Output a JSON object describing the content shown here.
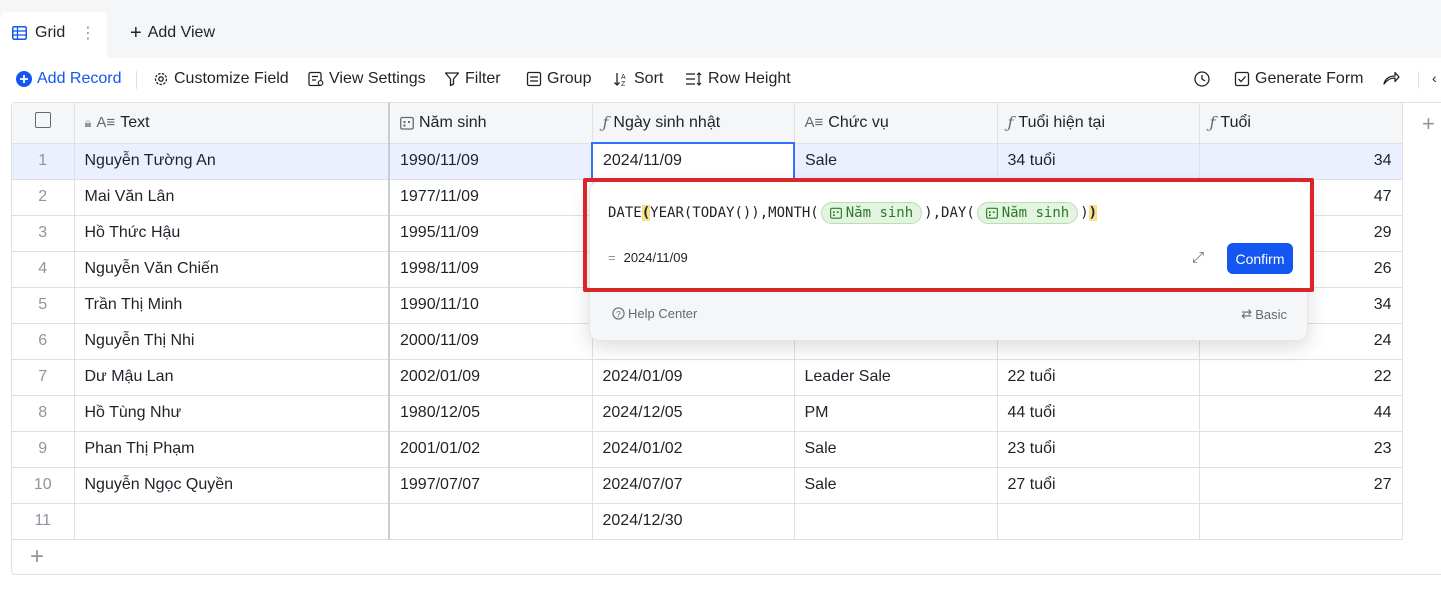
{
  "view_tabs": {
    "active": "Grid",
    "add_view": "Add View"
  },
  "toolbar": {
    "add_record": "Add Record",
    "customize_field": "Customize Field",
    "view_settings": "View Settings",
    "filter": "Filter",
    "group": "Group",
    "sort": "Sort",
    "row_height": "Row Height",
    "generate_form": "Generate Form"
  },
  "columns": [
    "Text",
    "Năm sinh",
    "Ngày sinh nhật",
    "Chức vụ",
    "Tuổi hiện tại",
    "Tuổi"
  ],
  "rows": [
    {
      "n": "1",
      "text": "Nguyễn Tường An",
      "nam_sinh": "1990/11/09",
      "ngay_sinh_nhat": "2024/11/09",
      "chuc_vu": "Sale",
      "tuoi_hien_tai": "34 tuổi",
      "tuoi": "34"
    },
    {
      "n": "2",
      "text": "Mai Văn Lân",
      "nam_sinh": "1977/11/09",
      "ngay_sinh_nhat": "",
      "chuc_vu": "",
      "tuoi_hien_tai": "",
      "tuoi": "47"
    },
    {
      "n": "3",
      "text": "Hồ Thức Hậu",
      "nam_sinh": "1995/11/09",
      "ngay_sinh_nhat": "",
      "chuc_vu": "",
      "tuoi_hien_tai": "",
      "tuoi": "29"
    },
    {
      "n": "4",
      "text": "Nguyễn Văn Chiến",
      "nam_sinh": "1998/11/09",
      "ngay_sinh_nhat": "",
      "chuc_vu": "",
      "tuoi_hien_tai": "",
      "tuoi": "26"
    },
    {
      "n": "5",
      "text": "Trần Thị Minh",
      "nam_sinh": "1990/11/10",
      "ngay_sinh_nhat": "",
      "chuc_vu": "",
      "tuoi_hien_tai": "",
      "tuoi": "34"
    },
    {
      "n": "6",
      "text": "Nguyễn Thị Nhi",
      "nam_sinh": "2000/11/09",
      "ngay_sinh_nhat": "",
      "chuc_vu": "",
      "tuoi_hien_tai": "",
      "tuoi": "24"
    },
    {
      "n": "7",
      "text": "Dư Mậu Lan",
      "nam_sinh": "2002/01/09",
      "ngay_sinh_nhat": "2024/01/09",
      "chuc_vu": "Leader Sale",
      "tuoi_hien_tai": "22 tuổi",
      "tuoi": "22"
    },
    {
      "n": "8",
      "text": "Hồ Tùng Như",
      "nam_sinh": "1980/12/05",
      "ngay_sinh_nhat": "2024/12/05",
      "chuc_vu": "PM",
      "tuoi_hien_tai": "44 tuổi",
      "tuoi": "44"
    },
    {
      "n": "9",
      "text": "Phan Thị Phạm",
      "nam_sinh": "2001/01/02",
      "ngay_sinh_nhat": "2024/01/02",
      "chuc_vu": "Sale",
      "tuoi_hien_tai": "23 tuổi",
      "tuoi": "23"
    },
    {
      "n": "10",
      "text": "Nguyễn Ngọc Quyền",
      "nam_sinh": "1997/07/07",
      "ngay_sinh_nhat": "2024/07/07",
      "chuc_vu": "Sale",
      "tuoi_hien_tai": "27 tuổi",
      "tuoi": "27"
    },
    {
      "n": "11",
      "text": "",
      "nam_sinh": "",
      "ngay_sinh_nhat": "2024/12/30",
      "chuc_vu": "",
      "tuoi_hien_tai": "",
      "tuoi": ""
    }
  ],
  "formula_editor": {
    "fn_date": "DATE",
    "open_paren": "(",
    "part_year": "YEAR(TODAY()),MONTH(",
    "field_token_1": "Năm sinh",
    "part_day": "),DAY(",
    "field_token_2": "Năm sinh",
    "inner_close": ")",
    "close_paren": ")",
    "result_eq": "=",
    "result_value": "2024/11/09",
    "confirm": "Confirm",
    "help_center": "Help Center",
    "basic": "Basic"
  },
  "colors": {
    "accent": "#1456f0",
    "highlight_box": "#d9262a",
    "selected_row": "#eaf0fe",
    "token_bg": "#e3f5e1"
  }
}
